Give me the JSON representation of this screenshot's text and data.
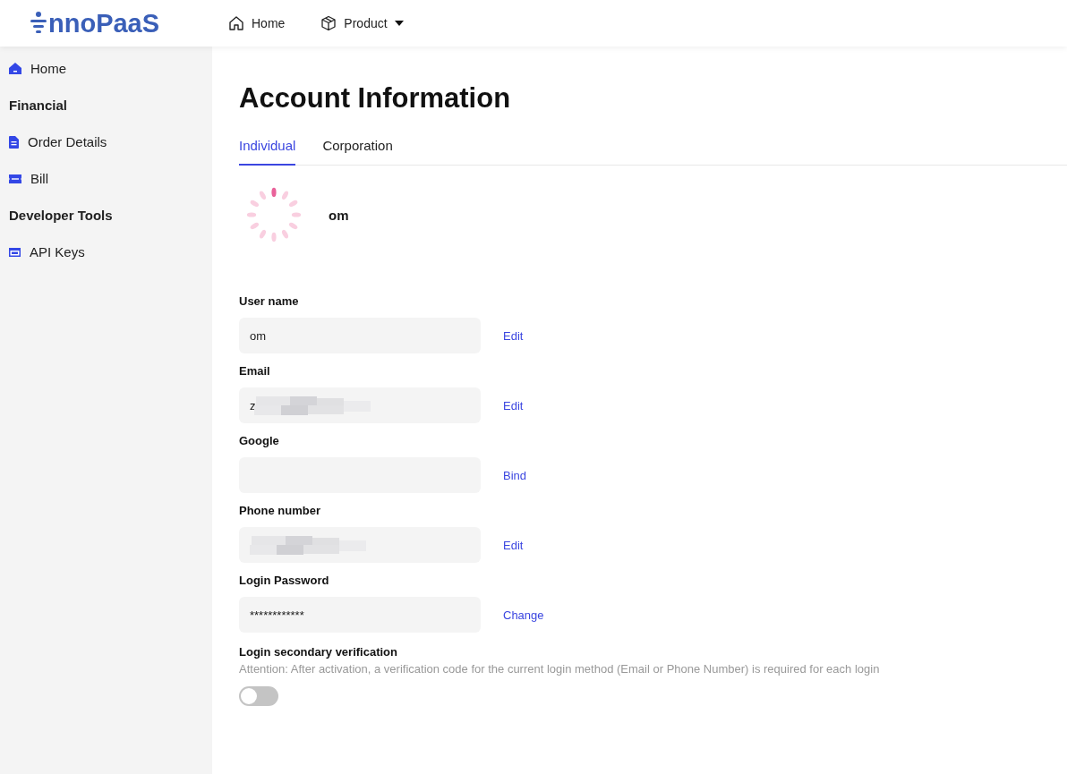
{
  "header": {
    "logo": "nnoPaaS",
    "nav": [
      {
        "label": "Home",
        "dropdown": false
      },
      {
        "label": "Product",
        "dropdown": true
      }
    ]
  },
  "sidebar": {
    "items": [
      {
        "kind": "link",
        "label": "Home"
      },
      {
        "kind": "heading",
        "label": "Financial"
      },
      {
        "kind": "link",
        "label": "Order Details"
      },
      {
        "kind": "link",
        "label": "Bill"
      },
      {
        "kind": "heading",
        "label": "Developer Tools"
      },
      {
        "kind": "link",
        "label": "API Keys"
      }
    ]
  },
  "page": {
    "title": "Account Information",
    "tabs": [
      {
        "label": "Individual",
        "selected": true
      },
      {
        "label": "Corporation",
        "selected": false
      }
    ],
    "profile": {
      "name": "om"
    },
    "fields": [
      {
        "label": "User name",
        "value": "om",
        "redacted": false,
        "action": "Edit"
      },
      {
        "label": "Email",
        "value": "z",
        "redacted": true,
        "action": "Edit"
      },
      {
        "label": "Google",
        "redacted": false,
        "action": "Bind"
      },
      {
        "label": "Phone number",
        "redacted": true,
        "action": "Edit"
      },
      {
        "label": "Login Password",
        "value": "************",
        "redacted": false,
        "action": "Change"
      }
    ],
    "verification": {
      "label": "Login secondary verification",
      "note": "Attention: After activation, a verification code for the current login method (Email or Phone Number) is required for each login",
      "on": false
    }
  }
}
